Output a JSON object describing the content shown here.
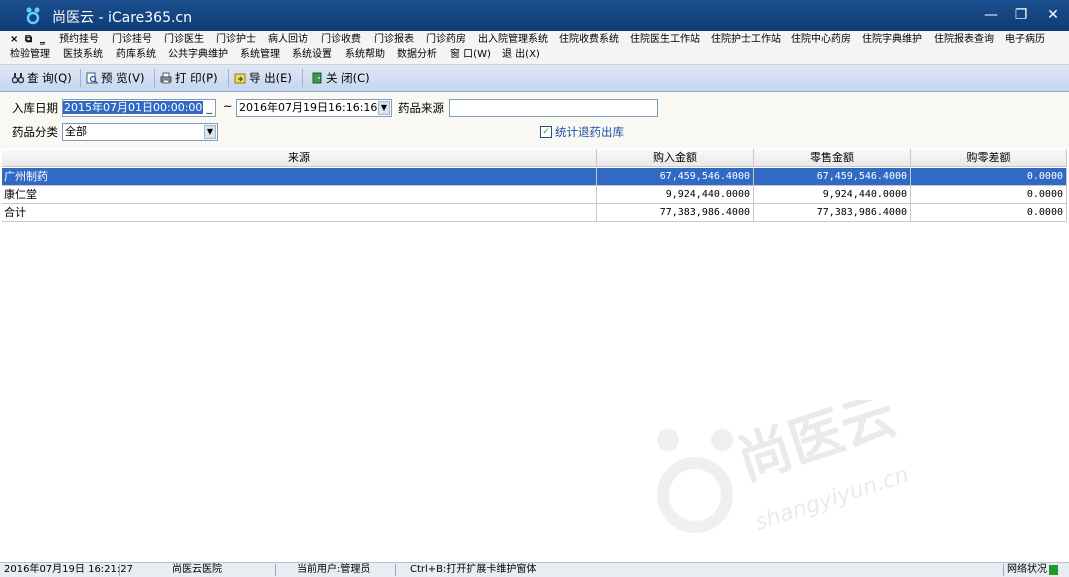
{
  "window": {
    "title": "尚医云 - iCare365.cn",
    "controls": [
      "minimize",
      "restore",
      "close"
    ]
  },
  "menubar": {
    "system_controls": [
      "×",
      "⧉",
      "‗"
    ],
    "row1": [
      "预约挂号",
      "门诊挂号",
      "门诊医生",
      "门诊护士",
      "病人回访",
      "门诊收费",
      "门诊报表",
      "门诊药房",
      "出入院管理系统",
      "住院收费系统",
      "住院医生工作站",
      "住院护士工作站",
      "住院中心药房",
      "住院字典维护",
      "住院报表查询",
      "电子病历"
    ],
    "row2": [
      "检验管理",
      "医技系统",
      "药库系统",
      "公共字典维护",
      "系统管理",
      "系统设置",
      "系统帮助",
      "数据分析",
      "窗 口(W)",
      "退 出(X)"
    ]
  },
  "toolbar": {
    "query": "查 询(Q)",
    "preview": "预 览(V)",
    "print": "打 印(P)",
    "export": "导 出(E)",
    "close": "关 闭(C)"
  },
  "filter": {
    "date_label": "入库日期",
    "date_from": "2015年07月01日00:00:00",
    "range_sep": "~",
    "date_to": "2016年07月19日16:16:16",
    "source_label": "药品来源",
    "source_value": "",
    "category_label": "药品分类",
    "category_value": "全部",
    "include_returns_label": "统计退药出库",
    "include_returns_checked": true
  },
  "table": {
    "columns": [
      "来源",
      "购入金额",
      "零售金额",
      "购零差额"
    ],
    "rows": [
      [
        "广州制药",
        "67,459,546.4000",
        "67,459,546.4000",
        "0.0000"
      ],
      [
        "康仁堂",
        "9,924,440.0000",
        "9,924,440.0000",
        "0.0000"
      ],
      [
        "合计",
        "77,383,986.4000",
        "77,383,986.4000",
        "0.0000"
      ]
    ],
    "selected_row": 0
  },
  "statusbar": {
    "datetime": "2016年07月19日 16:21:27",
    "hospital": "尚医云医院",
    "user": "当前用户:管理员",
    "hint": "Ctrl+B:打开扩展卡维护窗体",
    "network_label": "网络状况",
    "network_color": "#1e9a2c"
  },
  "watermark": {
    "brand": "尚医云",
    "site": "shangyiyun.cn"
  },
  "colors": {
    "titlebar": "#0f3c76",
    "selection": "#316ac5"
  }
}
